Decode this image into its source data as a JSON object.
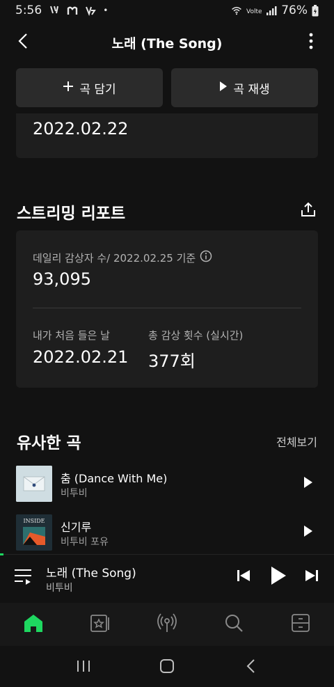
{
  "status_bar": {
    "time": "5:56",
    "battery": "76%",
    "indicators": "• "
  },
  "header": {
    "title": "노래 (The Song)"
  },
  "actions": {
    "add_label": "곡 담기",
    "play_label": "곡 재생"
  },
  "release": {
    "date": "2022.02.22"
  },
  "streaming_report": {
    "title": "스트리밍 리포트",
    "daily_listeners_label": "데일리 감상자 수/ 2022.02.25 기준",
    "daily_listeners_value": "93,095",
    "first_listened_label": "내가 처음 들은 날",
    "first_listened_value": "2022.02.21",
    "total_plays_label": "총 감상 횟수 (실시간)",
    "total_plays_value": "377회"
  },
  "similar": {
    "title": "유사한 곡",
    "see_all": "전체보기",
    "songs": [
      {
        "title": "춤 (Dance With Me)",
        "artist": "비투비"
      },
      {
        "title": "신기루",
        "artist": "비투비 포유",
        "cover_text": "INSIDE"
      }
    ]
  },
  "player": {
    "title": "노래 (The Song)",
    "artist": "비투비",
    "progress": 0.01
  },
  "nav": {
    "items": [
      "home-icon",
      "library-icon",
      "podcast-icon",
      "search-icon",
      "storage-icon"
    ],
    "active_color": "#1ed760"
  }
}
